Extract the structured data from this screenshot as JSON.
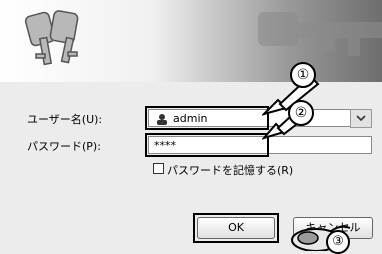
{
  "form": {
    "username_label": "ユーザー名(U):",
    "username_value": "admin",
    "password_label": "パスワード(P):",
    "password_value": "****",
    "remember_label": "パスワードを記憶する(R)"
  },
  "buttons": {
    "ok_label": "OK",
    "cancel_label": "キャンセル"
  },
  "callouts": [
    "①",
    "②",
    "③"
  ],
  "icons": {
    "banner": "keys-icon",
    "user": "user-icon",
    "dropdown": "chevron-down-icon",
    "mouse": "mouse-icon"
  }
}
